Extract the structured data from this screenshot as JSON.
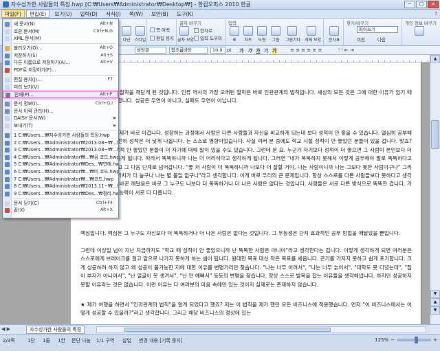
{
  "window": {
    "title": "자수성가한 사람들의 특징.hwp [C:₩Users₩Administrator₩Desktop₩] - 한컴오피스 2010 한글",
    "controls": {
      "minimize": "─",
      "maximize": "□",
      "close": "✕"
    }
  },
  "menubar": {
    "items": [
      {
        "label": "파일(F)"
      },
      {
        "label": "편집(E)"
      },
      {
        "label": "보기(U)"
      },
      {
        "label": "입력(D)"
      },
      {
        "label": "서식(J)"
      },
      {
        "label": "쪽(W)"
      },
      {
        "label": "보안(B)"
      },
      {
        "label": "도구(K)"
      }
    ],
    "right": "?"
  },
  "ribbon": {
    "groups": [
      {
        "name": "글자 바꾸기"
      },
      {
        "name": "입력"
      },
      {
        "name": "찾기/바꾸기"
      },
      {
        "name": "개인 정보 바꾸기"
      }
    ],
    "buttons": [
      "다단",
      "스타일",
      "쪽 여백",
      "구역 설정",
      "글자 모양",
      "문단 모양",
      "나누기",
      "한자로",
      "글자 바꾸기",
      "표",
      "차트",
      "도형",
      "그림",
      "그림기타",
      "개체 모양",
      "문자표",
      "글상자",
      "찾기",
      "바꾸기",
      "이동",
      "찾아가기"
    ],
    "small_items": [
      "쪽 여백",
      "편집 용지",
      "한자로",
      "입력 도우미",
      "글자 바꾸기"
    ],
    "find_input": "띄어쓰기",
    "find_prev": "이전",
    "find_next": "다음"
  },
  "format_toolbar": {
    "style": "바탕글",
    "font": "함초롬바탕",
    "size": "10.0",
    "unit": "pt",
    "buttons": [
      "가",
      "가",
      "가",
      "가",
      "가"
    ]
  },
  "file_menu": {
    "items": [
      {
        "label": "새 문서(N)",
        "shortcut": "Alt+N",
        "icon_color": "#6f8fc8"
      },
      {
        "label": "호환 문서(M)",
        "shortcut": "Ctrl+N,G",
        "icon_color": "#c9d6ea"
      },
      {
        "label": "XML 문서(M)",
        "shortcut": "",
        "icon_color": "#c9d6ea"
      },
      {
        "sep": true
      },
      {
        "label": "불러오기(O)...",
        "shortcut": "Alt+O",
        "icon_color": "#e3b048"
      },
      {
        "label": "저장하기(S)",
        "shortcut": "Alt+S",
        "icon_color": "#5b88c9"
      },
      {
        "label": "다른 이름으로 저장하기(A)...",
        "shortcut": "Alt+V",
        "icon_color": "#5b88c9"
      },
      {
        "label": "PDF로 저장하기(F)...",
        "shortcut": "",
        "icon_color": "#d64a3b"
      },
      {
        "sep": true
      },
      {
        "label": "편집 용지(J)...",
        "shortcut": "F7",
        "icon_color": "#c9d6ea"
      },
      {
        "label": "미리 보기(V)",
        "shortcut": "",
        "icon_color": "#c9d6ea"
      },
      {
        "label": "인쇄(P)...",
        "shortcut": "Alt+P",
        "icon_color": "#6b7f99",
        "highlight": true
      },
      {
        "sep": true
      },
      {
        "label": "문서 정보(I)...",
        "shortcut": "Ctrl+Q,I",
        "icon_color": "#6f8fc8"
      },
      {
        "label": "문서 이력 관리(H)...",
        "shortcut": "",
        "icon_color": "#6f8fc8"
      },
      {
        "label": "DAISY 문서(W)",
        "shortcut": "",
        "icon_color": "#c9d6ea",
        "submenu": true
      },
      {
        "label": "보내기(T)",
        "shortcut": "",
        "icon_color": "#c9d6ea",
        "submenu": true
      },
      {
        "sep": true
      },
      {
        "label": "1 C:₩Users...₩자수성가한 사람들의 특징.hwp",
        "shortcut": "",
        "icon_color": "#5b88c9"
      },
      {
        "label": "2 C:₩Users...₩Administrator₩2013.08~₩...hwp",
        "shortcut": "",
        "icon_color": "#5b88c9"
      },
      {
        "label": "3 C:₩Users...₩Administrator₩2013.08~₩...hwp",
        "shortcut": "",
        "icon_color": "#5b88c9"
      },
      {
        "label": "4 C:₩Users...₩Administrator₩...₩곰 코드.hwp",
        "shortcut": "",
        "icon_color": "#5b88c9"
      },
      {
        "label": "5 C:₩Users...₩Administrator₩Des...₩연애.hwp",
        "shortcut": "",
        "icon_color": "#5b88c9"
      },
      {
        "label": "6 C:₩Users...₩Administrator₩...₩미 코드.hwp",
        "shortcut": "",
        "icon_color": "#5b88c9"
      },
      {
        "label": "7 C:₩Users...₩Administrator₩...₩코드.hwp",
        "shortcut": "",
        "icon_color": "#5b88c9"
      },
      {
        "label": "8 C:₩Users...₩Administrator₩2013.11~₩...hwp",
        "shortcut": "",
        "icon_color": "#5b88c9"
      },
      {
        "label": "9 C:₩Users...₩Administrator₩Des...₩정리.hwp",
        "shortcut": "",
        "icon_color": "#5b88c9"
      },
      {
        "sep": true
      },
      {
        "label": "문서 닫기(C)",
        "shortcut": "Ctrl+F4",
        "icon_color": "#c9d6ea"
      },
      {
        "label": "끝(X)",
        "shortcut": "Alt+X",
        "icon_color": "#d64a3b"
      }
    ]
  },
  "annotation": "여기",
  "document": {
    "paragraphs": [
      "를 해보면 오래된 철학을 깨닫게 된 것입니다. 인류 역사의 가장 오래된 철학은 바로 인관관계의 법칙입니다. 세상의 모든 것은 그에 대한 이유가 있기 때문에 발생한다고 합니다. 성공은 우연이 아니고, 실패도 우연이 아닙니다.",
      "을에 있어서 큰 문제가 바로 이겁니다. 성장하는 과정에서 사람은 다른 사람들과 자신을 비교하게 되는데 보다 성적이 안 좋을 수 있습니다. 열심히 공부해 보지만 그래도 여전히 성적은 더 낮게 나옵니다. 는 스스로 영향이었습니다. 사실 여러 분 중에도 학교 시절 성적이 안 좋았던 분들이 있을 겁니다. 맞죠? 알겁니다(웃음) 성적 안 좋았던 분들이 더 자기에 대해 말이 있을 수도 있습니다. 그런데 문 요. 누군가 자기보다 성적이 더 좋으면 그 사람이 본인보다 더 똑똑하다고 생각하게 됩니다. 따라서 똑똑하니까 나는 더 어리석다고 생각하게 됩니다. 그러면 \"내가 똑똑하지 못해서 이렇게 공부해야 말로 똑똑하다고 생각합니다. 그리고 그 다음 단계로 넘어갑니다. \"좋 저 사람이 더 똑똑하니까 나보다 더 잘할 거야, 나는 사람이니까 나는 그보다 못한 사람이구나\" 그리고는 \"저 사람의 가치가 더 높구나 나는 별 볼일 없구나\"라고 생각합니다. 이게 바로 우리의 큰 문제입니다. 항상 스스로를 다른 사람들보다 못하다고 생각하게 되고 성장을 바꾼 깨달음은 바로 그 누구도 나보다 더 똑똑하거나 더 나은 사람은 없다는 것입니다. 사람들은 서로 다른 방식으로 똑똑한 겁니다. 가지고 있는 재능과 능력이 서로 다 다릅니다.",
      "핵심입니다. 핵심은 그 누구도 자신보다 더 똑똑하거나 더 나은 사람은 없다는 것입니다. 그 우등생은 단지 효과적인 공부 방법을 깨달았을 뿐입니다.",
      "그런데 이상일 넘이 지난 지금까지도 \"학교 때 성적이 안 좋았으니까 난 똑똑한 사람은 아니야\"라고 생각한다는 겁니다. 이렇게 생각하게 되면 여러분은 스스로에게 브레이크를 걸고 앞으로 나가지 못하게 하는 셈이 됩니다. 원대한 목표 대신 작은 목표를 세웁니다. 끈기를 가지지 못하고 쉽게 포기합니다. 크게 성공하려 하지 않고 왜 성공이 불가능한 지에 대한 이유를 변명거리만 찾습니다. \"나는 너무 어려서\", \"나는 너무 늙어서\", \"대학도 못 다녔는데\", \"집이 부자가 아니어서\", \"난 얼굴이 못 생겨서\", \"난 안 예뻐서\" 등등의 변명을 찾습니다. 항상 스스로 발목을 잡는 이유들을 생각해냅니다. 하지만 성공하지 못할 이유라는 것은 없습니다. 이런 이유는 다 여러분의 마음 속에만 있는 것이지 실제로는 존재하지 않습니다.",
      "★ 제가 여행을 하면서 \"인과관계의 법칙\"을 알게 되었다고 했죠? 저는 이 법칙을 제가 했던 모든 비즈니스에 적용했습니다. 먼저 \"이 비즈니스에서는 어떻게 성공할 수 있을까?\"라고 생각합니다. 그리고 해당 비즈니스의 정상에 있는"
    ]
  },
  "tabbar": {
    "doc_tab": "자수성가한 사람들의 특징",
    "nav": "◀ ▶"
  },
  "statusbar": {
    "items": [
      "2/3쪽",
      "1단",
      "1줄",
      "1칸",
      "문단 나눔",
      "1/1 구역",
      "삽입",
      "변경 내용 [기록 중지]"
    ],
    "zoom": "125%"
  }
}
